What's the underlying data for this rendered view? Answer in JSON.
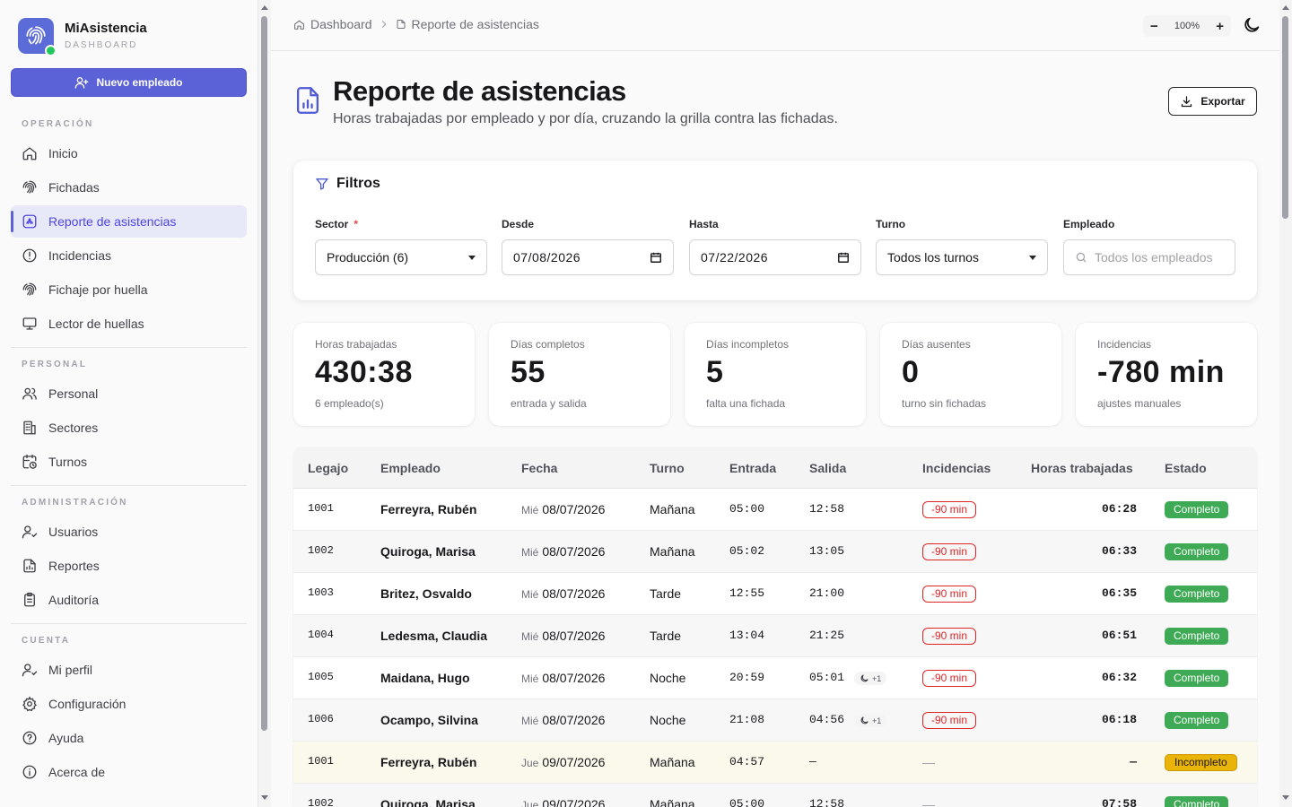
{
  "app": {
    "name": "MiAsistencia",
    "subtitle": "DASHBOARD"
  },
  "sidebar": {
    "new_button": "Nuevo empleado",
    "sections": [
      {
        "label": "OPERACIÓN",
        "items": [
          "Inicio",
          "Fichadas",
          "Reporte de asistencias",
          "Incidencias",
          "Fichaje por huella",
          "Lector de huellas"
        ]
      },
      {
        "label": "PERSONAL",
        "items": [
          "Personal",
          "Sectores",
          "Turnos"
        ]
      },
      {
        "label": "ADMINISTRACIÓN",
        "items": [
          "Usuarios",
          "Reportes",
          "Auditoría"
        ]
      },
      {
        "label": "CUENTA",
        "items": [
          "Mi perfil",
          "Configuración",
          "Ayuda",
          "Acerca de"
        ]
      }
    ],
    "active_item": "Reporte de asistencias"
  },
  "topbar": {
    "breadcrumb": [
      "Dashboard",
      "Reporte de asistencias"
    ],
    "zoom": "100%",
    "zoom_minus": "−",
    "zoom_plus": "+"
  },
  "header": {
    "title": "Reporte de asistencias",
    "subtitle": "Horas trabajadas por empleado y por día, cruzando la grilla contra las fichadas.",
    "export_label": "Exportar"
  },
  "filters": {
    "title": "Filtros",
    "sector": {
      "label": "Sector",
      "required": "*",
      "value": "Producción (6)"
    },
    "desde": {
      "label": "Desde",
      "value": "07/08/2026"
    },
    "hasta": {
      "label": "Hasta",
      "value": "07/22/2026"
    },
    "turno": {
      "label": "Turno",
      "value": "Todos los turnos"
    },
    "empleado": {
      "label": "Empleado",
      "placeholder": "Todos los empleados"
    }
  },
  "stats": [
    {
      "label": "Horas trabajadas",
      "value": "430:38",
      "note": "6 empleado(s)"
    },
    {
      "label": "Días completos",
      "value": "55",
      "note": "entrada y salida"
    },
    {
      "label": "Días incompletos",
      "value": "5",
      "note": "falta una fichada"
    },
    {
      "label": "Días ausentes",
      "value": "0",
      "note": "turno sin fichadas"
    },
    {
      "label": "Incidencias",
      "value": "-780 min",
      "note": "ajustes manuales"
    }
  ],
  "table": {
    "headers": [
      "Legajo",
      "Empleado",
      "Fecha",
      "Turno",
      "Entrada",
      "Salida",
      "Incidencias",
      "Horas trabajadas",
      "Estado"
    ],
    "rows": [
      {
        "legajo": "1001",
        "empleado": "Ferreyra, Rubén",
        "dow": "Mié",
        "fecha": "08/07/2026",
        "turno": "Mañana",
        "entrada": "05:00",
        "salida": "12:58",
        "night": "",
        "incidencia": "-90 min",
        "horas": "06:28",
        "estado": "Completo"
      },
      {
        "legajo": "1002",
        "empleado": "Quiroga, Marisa",
        "dow": "Mié",
        "fecha": "08/07/2026",
        "turno": "Mañana",
        "entrada": "05:02",
        "salida": "13:05",
        "night": "",
        "incidencia": "-90 min",
        "horas": "06:33",
        "estado": "Completo"
      },
      {
        "legajo": "1003",
        "empleado": "Britez, Osvaldo",
        "dow": "Mié",
        "fecha": "08/07/2026",
        "turno": "Tarde",
        "entrada": "12:55",
        "salida": "21:00",
        "night": "",
        "incidencia": "-90 min",
        "horas": "06:35",
        "estado": "Completo"
      },
      {
        "legajo": "1004",
        "empleado": "Ledesma, Claudia",
        "dow": "Mié",
        "fecha": "08/07/2026",
        "turno": "Tarde",
        "entrada": "13:04",
        "salida": "21:25",
        "night": "",
        "incidencia": "-90 min",
        "horas": "06:51",
        "estado": "Completo"
      },
      {
        "legajo": "1005",
        "empleado": "Maidana, Hugo",
        "dow": "Mié",
        "fecha": "08/07/2026",
        "turno": "Noche",
        "entrada": "20:59",
        "salida": "05:01",
        "night": "+1",
        "incidencia": "-90 min",
        "horas": "06:32",
        "estado": "Completo"
      },
      {
        "legajo": "1006",
        "empleado": "Ocampo, Silvina",
        "dow": "Mié",
        "fecha": "08/07/2026",
        "turno": "Noche",
        "entrada": "21:08",
        "salida": "04:56",
        "night": "+1",
        "incidencia": "-90 min",
        "horas": "06:18",
        "estado": "Completo"
      },
      {
        "legajo": "1001",
        "empleado": "Ferreyra, Rubén",
        "dow": "Jue",
        "fecha": "09/07/2026",
        "turno": "Mañana",
        "entrada": "04:57",
        "salida": "—",
        "night": "",
        "incidencia": "—",
        "horas": "—",
        "estado": "Incompleto"
      },
      {
        "legajo": "1002",
        "empleado": "Quiroga, Marisa",
        "dow": "Jue",
        "fecha": "09/07/2026",
        "turno": "Mañana",
        "entrada": "05:00",
        "salida": "12:58",
        "night": "",
        "incidencia": "—",
        "horas": "07:58",
        "estado": "Completo"
      }
    ]
  },
  "colors": {
    "accent": "#5b61d6",
    "complete": "#3faa55",
    "incomplete": "#eab308",
    "incident": "#dc2626"
  }
}
